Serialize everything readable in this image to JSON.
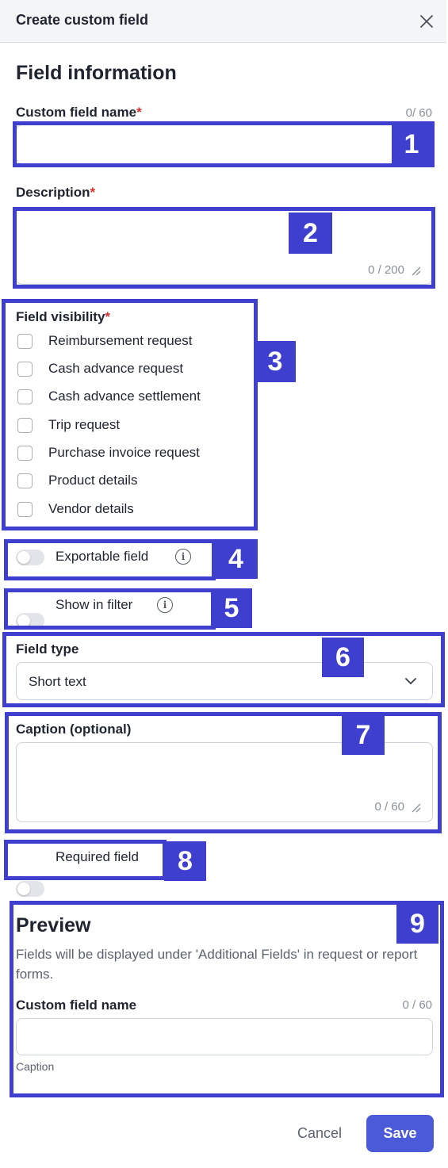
{
  "header": {
    "title": "Create custom field"
  },
  "section_title": "Field information",
  "custom_field_name": {
    "label": "Custom field name",
    "required_mark": "*",
    "counter": "0/ 60",
    "value": ""
  },
  "description": {
    "label": "Description",
    "required_mark": "*",
    "counter": "0 / 200",
    "value": ""
  },
  "field_visibility": {
    "label": "Field visibility",
    "required_mark": "*",
    "options": [
      "Reimbursement request",
      "Cash advance request",
      "Cash advance settlement",
      "Trip request",
      "Purchase invoice request",
      "Product details",
      "Vendor details"
    ]
  },
  "exportable_field": {
    "label": "Exportable field",
    "enabled": false,
    "info": "i"
  },
  "show_in_filter": {
    "label": "Show in filter",
    "enabled": false,
    "info": "i"
  },
  "field_type": {
    "label": "Field type",
    "selected": "Short text"
  },
  "caption": {
    "label": "Caption (optional)",
    "counter": "0 / 60",
    "value": ""
  },
  "required_field": {
    "label": "Required field",
    "enabled": false
  },
  "preview": {
    "title": "Preview",
    "description": "Fields will be displayed under 'Additional Fields' in request or report forms.",
    "field_label": "Custom field name",
    "counter": "0 / 60",
    "caption": "Caption"
  },
  "footer": {
    "cancel": "Cancel",
    "save": "Save"
  },
  "annotations": [
    "1",
    "2",
    "3",
    "4",
    "5",
    "6",
    "7",
    "8",
    "9"
  ],
  "colors": {
    "annotation": "#3f3fcf",
    "primary_button": "#4a5ad8",
    "required": "#d92f2f"
  }
}
